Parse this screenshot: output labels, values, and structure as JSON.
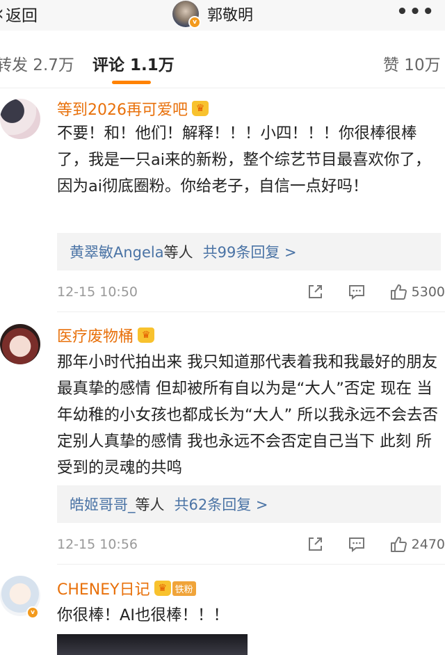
{
  "header": {
    "back_label": "返回",
    "title": "郭敬明",
    "more": "•••"
  },
  "tabs": {
    "repost": "转发 2.7万",
    "comment": "评论 1.1万",
    "like": "赞 10万",
    "active_color": "#ff8200"
  },
  "comments": [
    {
      "user": "等到2026再可爱吧",
      "text": "不要！和！他们！解释！！！小四！！！你很棒很棒了，我是一只ai来的新粉，整个综艺节目最喜欢你了，因为ai彻底圈粉。你给老子，自信一点好吗！",
      "reply_users": "黄翠敏Angela",
      "reply_suffix": "等人",
      "reply_count": "共99条回复 >",
      "time": "12-15 10:50",
      "likes": "5300"
    },
    {
      "user": "医疗废物桶",
      "text": "那年小时代拍出来 我只知道那代表着我和我最好的朋友最真挚的感情 但却被所有自以为是“大人”否定 现在 当年幼稚的小女孩也都成长为“大人” 所以我永远不会去否定别人真挚的感情 我也永远不会否定自己当下 此刻 所受到的灵魂的共鸣",
      "reply_users": "皓姬哥哥_",
      "reply_suffix": "等人",
      "reply_count": "共62条回复 >",
      "time": "12-15 10:56",
      "likes": "2470"
    },
    {
      "user": "CHENEY日记",
      "badge": "铁粉",
      "text": "你很棒！AI也很棒！！！"
    }
  ],
  "icons": [
    "back-chevron-icon",
    "more-icon",
    "share-icon",
    "comment-icon",
    "like-icon",
    "crown-icon",
    "verified-icon"
  ]
}
